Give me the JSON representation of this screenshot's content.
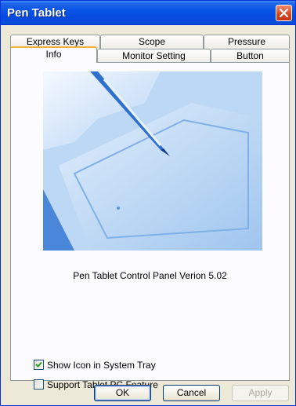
{
  "window": {
    "title": "Pen Tablet"
  },
  "tabs": {
    "row_back": [
      "Express Keys",
      "Scope",
      "Pressure"
    ],
    "row_front": [
      "Info",
      "Monitor Setting",
      "Button"
    ],
    "active": "Info"
  },
  "info": {
    "version_text": "Pen Tablet Control Panel Verion 5.02"
  },
  "options": [
    {
      "label": "Show Icon in System Tray",
      "checked": true
    },
    {
      "label": "Support Tablet PC Feature",
      "checked": false
    }
  ],
  "buttons": {
    "ok": "OK",
    "cancel": "Cancel",
    "apply": "Apply"
  },
  "colors": {
    "titlebar": "#0a56e8",
    "close": "#d9441f",
    "active_tab_accent": "#f5b238"
  }
}
